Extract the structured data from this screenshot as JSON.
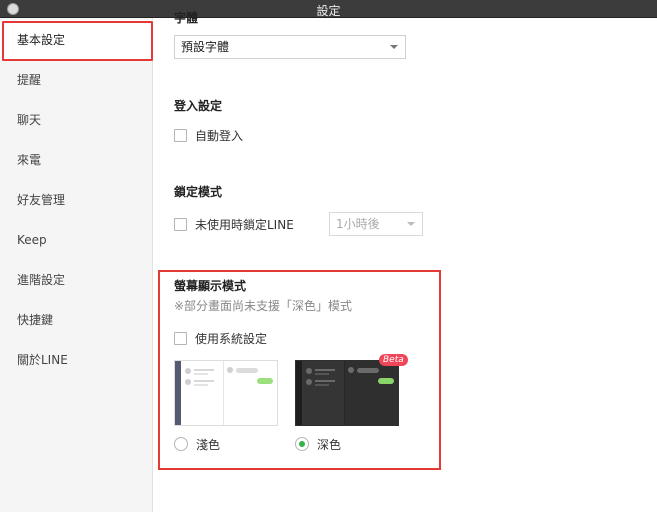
{
  "window": {
    "title": "設定"
  },
  "sidebar": {
    "items": [
      {
        "label": "基本設定",
        "active": true
      },
      {
        "label": "提醒"
      },
      {
        "label": "聊天"
      },
      {
        "label": "來電"
      },
      {
        "label": "好友管理"
      },
      {
        "label": "Keep"
      },
      {
        "label": "進階設定"
      },
      {
        "label": "快捷鍵"
      },
      {
        "label": "關於LINE"
      }
    ]
  },
  "main": {
    "font": {
      "heading": "字體",
      "select_value": "預設字體"
    },
    "login": {
      "title": "登入設定",
      "auto_login_label": "自動登入",
      "auto_login_checked": false
    },
    "lock": {
      "title": "鎖定模式",
      "checkbox_label": "未使用時鎖定LINE",
      "checked": false,
      "select_value": "1小時後"
    },
    "display": {
      "title": "螢幕顯示模式",
      "note": "※部分畫面尚未支援「深色」模式",
      "system_label": "使用系統設定",
      "system_checked": false,
      "beta_label": "Beta",
      "options": [
        {
          "label": "淺色",
          "selected": false
        },
        {
          "label": "深色",
          "selected": true
        }
      ]
    }
  },
  "colors": {
    "accent_green": "#34b34a",
    "highlight_red": "#e53935",
    "beta_red": "#f0465a"
  }
}
